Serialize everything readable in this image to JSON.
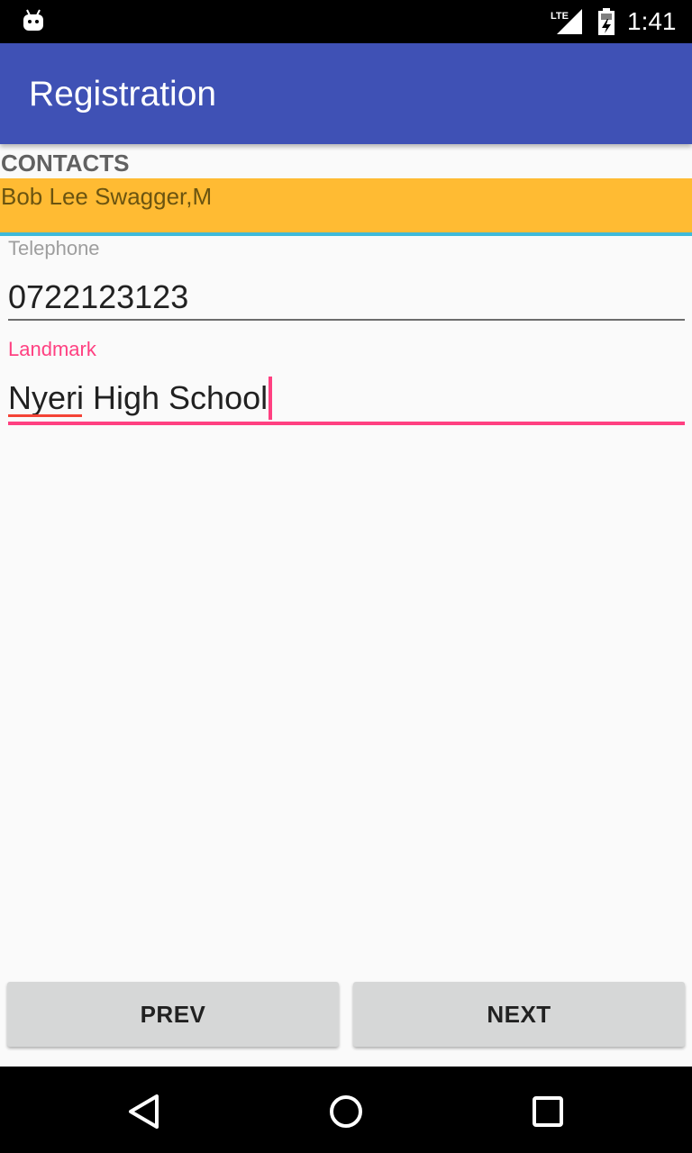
{
  "status_bar": {
    "time": "1:41",
    "network_label": "LTE",
    "icons": [
      "android-debug-icon",
      "lte-signal-icon",
      "battery-icon"
    ]
  },
  "app_bar": {
    "title": "Registration"
  },
  "section": {
    "header": "CONTACTS"
  },
  "contact": {
    "name": "Bob Lee Swagger,M"
  },
  "form": {
    "telephone": {
      "label": "Telephone",
      "value": "0722123123"
    },
    "landmark": {
      "label": "Landmark",
      "value": "Nyeri High School"
    }
  },
  "buttons": {
    "prev": "PREV",
    "next": "NEXT"
  },
  "nav_bar": {
    "icons": [
      "back-icon",
      "home-icon",
      "recents-icon"
    ]
  },
  "colors": {
    "app_bar": "#3f51b5",
    "accent": "#ff4081",
    "contact_banner": "#ffbb33",
    "banner_underline": "#3fbad9",
    "button": "#d6d7d7"
  }
}
